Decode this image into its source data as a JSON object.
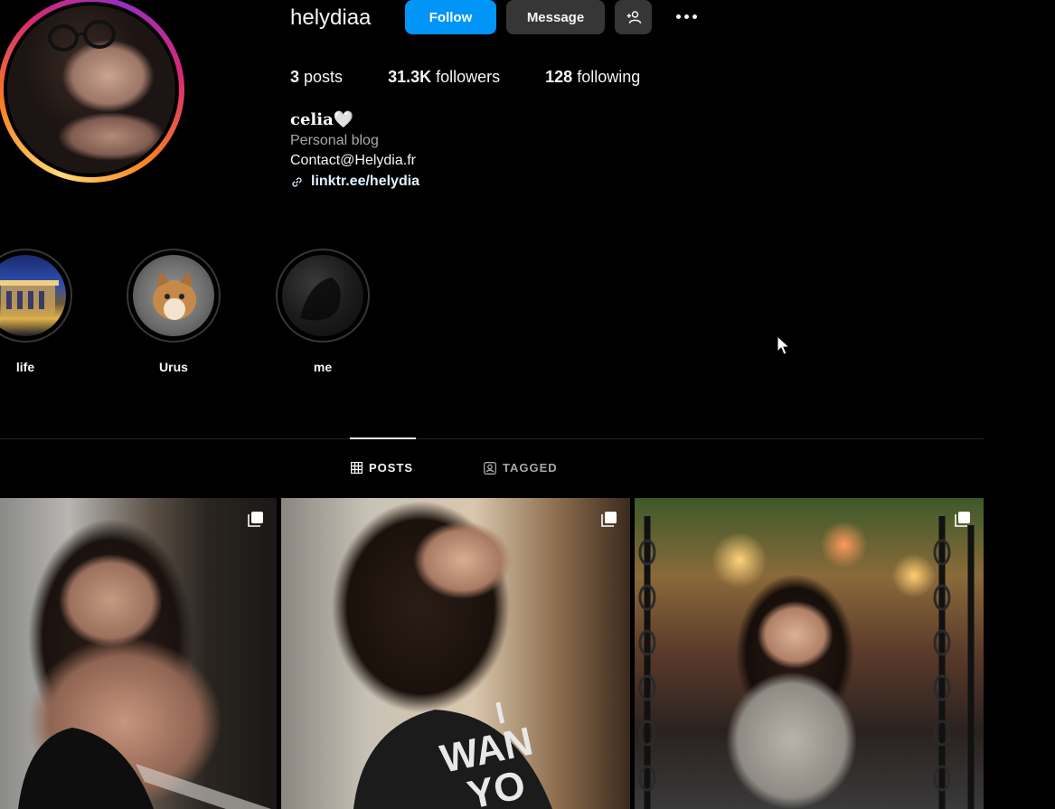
{
  "profile": {
    "username": "helydiaa",
    "follow_label": "Follow",
    "message_label": "Message",
    "stats": {
      "posts_count": "3",
      "posts_label": "posts",
      "followers_count": "31.3K",
      "followers_label": "followers",
      "following_count": "128",
      "following_label": "following"
    },
    "full_name": "celia🤍",
    "category": "Personal blog",
    "contact": "Contact@Helydia.fr",
    "link": "linktr.ee/helydia"
  },
  "highlights": [
    {
      "label": "life"
    },
    {
      "label": "Urus"
    },
    {
      "label": "me"
    }
  ],
  "tabs": {
    "posts_label": "POSTS",
    "tagged_label": "TAGGED",
    "active": "POSTS"
  },
  "posts": [
    {
      "type": "carousel"
    },
    {
      "type": "carousel",
      "shirt_text": "I WAN YO"
    },
    {
      "type": "carousel"
    }
  ],
  "colors": {
    "background": "#000000",
    "follow_button": "#0095f6",
    "secondary_button": "#363636"
  }
}
